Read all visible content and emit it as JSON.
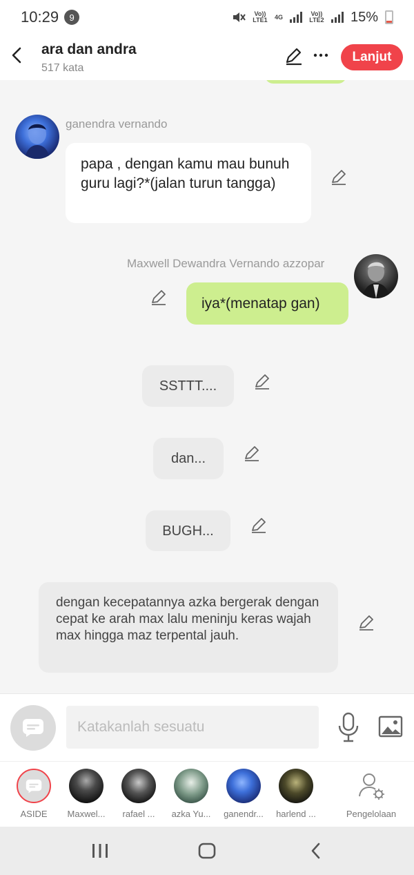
{
  "status": {
    "time": "10:29",
    "notif_count": "9",
    "sim1": "Vo)) LTE1",
    "net1": "4G",
    "sim2": "Vo)) LTE2",
    "battery": "15%"
  },
  "header": {
    "title": "ara dan andra",
    "subtitle": "517 kata",
    "next_label": "Lanjut"
  },
  "messages": {
    "m1": {
      "name": "ganendra vernando",
      "text": "papa , dengan kamu mau bunuh guru lagi?*(jalan turun tangga)"
    },
    "m2": {
      "name": "Maxwell Dewandra Vernando azzopar",
      "text": "iya*(menatap gan)"
    },
    "m3": {
      "text": "SSTTT...."
    },
    "m4": {
      "text": "dan..."
    },
    "m5": {
      "text": "BUGH..."
    },
    "m6": {
      "text": "dengan kecepatannya azka bergerak dengan cepat ke arah max lalu meninju keras wajah max hingga maz terpental jauh."
    }
  },
  "input": {
    "placeholder": "Katakanlah sesuatu"
  },
  "characters": [
    {
      "label": "ASIDE"
    },
    {
      "label": "Maxwel..."
    },
    {
      "label": "rafael ..."
    },
    {
      "label": "azka Yu..."
    },
    {
      "label": "ganendr..."
    },
    {
      "label": "harlend ..."
    },
    {
      "label": "Pengelolaan"
    }
  ],
  "colors": {
    "accent": "#f0434a",
    "green_bubble": "#cdee8f",
    "grey_bubble": "#ebebeb"
  }
}
